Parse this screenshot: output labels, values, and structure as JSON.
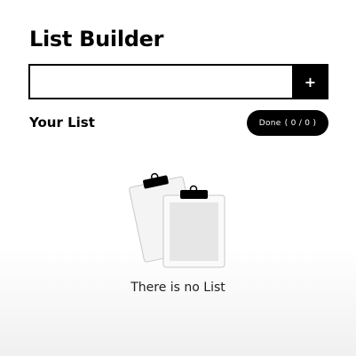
{
  "header": {
    "title": "List Builder"
  },
  "add_form": {
    "input_value": "",
    "input_placeholder": "",
    "add_label": "+"
  },
  "list": {
    "section_title": "Your List",
    "done_label": "Done",
    "done_count": "( 0 / 0 )"
  },
  "empty_state": {
    "icon": "clipboard-icon",
    "message": "There is no List"
  },
  "colors": {
    "accent": "#000000",
    "background": "#ffffff",
    "text": "#111111"
  }
}
